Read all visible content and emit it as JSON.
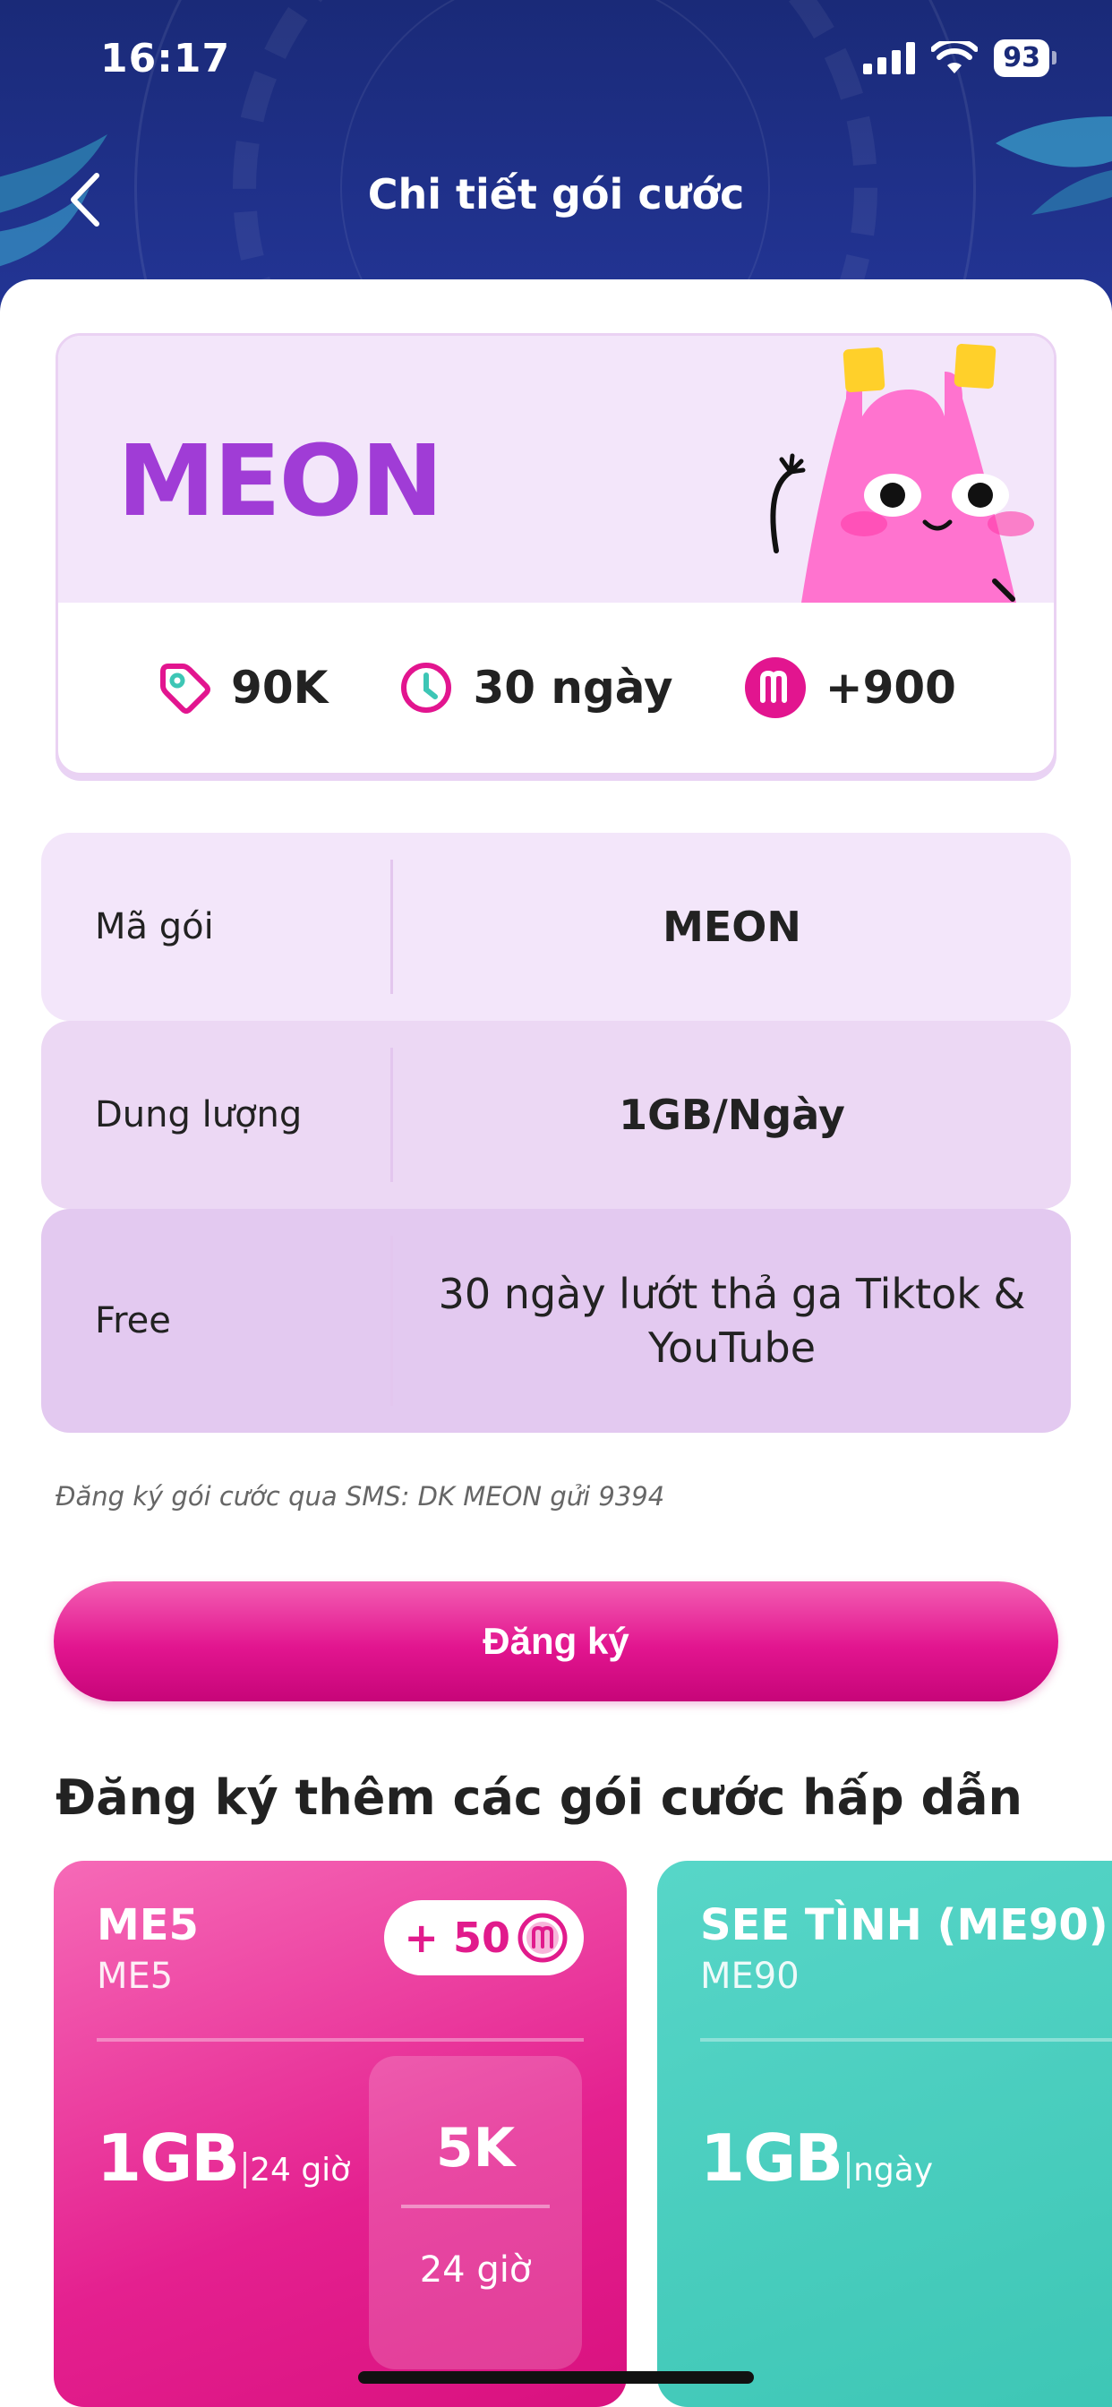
{
  "status_bar": {
    "time": "16:17",
    "battery": "93"
  },
  "header": {
    "title": "Chi tiết gói cước"
  },
  "package": {
    "name": "MEON",
    "price": "90K",
    "duration": "30 ngày",
    "points": "+900"
  },
  "details": [
    {
      "label": "Mã gói",
      "value": "MEON"
    },
    {
      "label": "Dung lượng",
      "value": "1GB/Ngày"
    },
    {
      "label": "Free",
      "value": "30 ngày lướt thả ga Tiktok & YouTube"
    }
  ],
  "sms_note": "Đăng ký gói cước qua SMS: DK MEON gửi 9394",
  "register_label": "Đăng ký",
  "more_section_title": "Đăng ký thêm các gói cước hấp dẫn",
  "suggestions": [
    {
      "name": "ME5",
      "code": "ME5",
      "bonus": "+ 50",
      "data": "1GB",
      "unit": "24 giờ",
      "price": "5K",
      "period": "24 giờ",
      "color": "#e4208f"
    },
    {
      "name": "SEE TÌNH (ME90)",
      "code": "ME90",
      "data": "1GB",
      "unit": "ngày",
      "color": "#3dc6b5"
    }
  ],
  "colors": {
    "header": "#1a2a78",
    "brand_purple": "#a03cd6",
    "brand_pink": "#e2158f"
  }
}
